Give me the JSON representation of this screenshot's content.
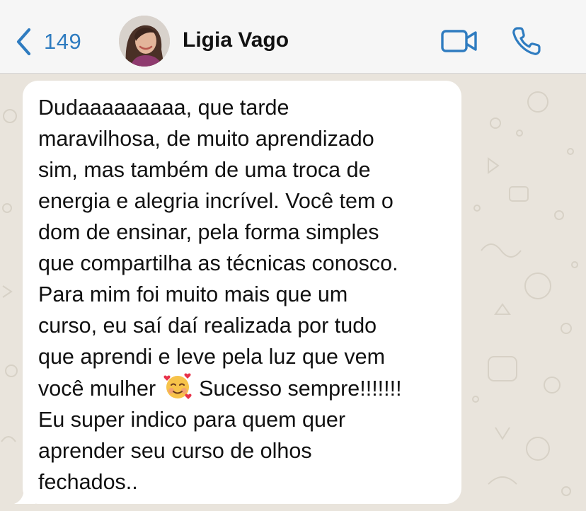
{
  "header": {
    "back_count": "149",
    "contact_name": "Ligia Vago"
  },
  "message": {
    "part1": "Dudaaaaaaaaa, que tarde\nmaravilhosa, de muito aprendizado\nsim, mas também de uma troca de\nenergia e alegria incrível. Você tem o\ndom de ensinar, pela forma simples\nque compartilha as técnicas conosco.\nPara mim foi muito mais que um\ncurso, eu saí daí realizada por tudo\nque aprendi e leve pela luz que vem\nvocê mulher ",
    "emoji_name": "smiling-face-with-hearts",
    "part2": " Sucesso sempre!!!!!!!\nEu super indico para quem quer\naprender seu curso de olhos\nfechados.."
  },
  "colors": {
    "accent": "#2f7cc0",
    "header_bg": "#f6f6f6",
    "chat_bg": "#e9e4dc",
    "bubble": "#ffffff"
  }
}
